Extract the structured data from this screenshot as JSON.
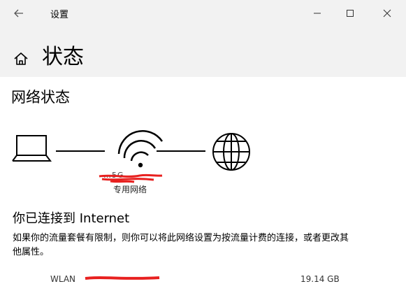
{
  "titlebar": {
    "back_icon": "arrow-left-icon",
    "title": "设置",
    "min_icon": "minimize-icon",
    "max_icon": "maximize-icon",
    "close_icon": "close-icon"
  },
  "header": {
    "home_icon": "home-icon",
    "title": "状态"
  },
  "network_status": {
    "section_title": "网络状态",
    "icons": [
      "laptop-icon",
      "wifi-icon",
      "globe-icon"
    ],
    "network_name": "…5G",
    "network_profile": "专用网络",
    "connected_text": "你已连接到 Internet",
    "description": "如果你的流量套餐有限制，则你可以将此网络设置为按流量计费的连接，或者更改其他属性。"
  },
  "usage": {
    "adapter_label": "WLAN",
    "data_used": "19.14 GB"
  },
  "colors": {
    "titlebar_bg": "#f2f2f2",
    "redaction": "#e8201f"
  }
}
